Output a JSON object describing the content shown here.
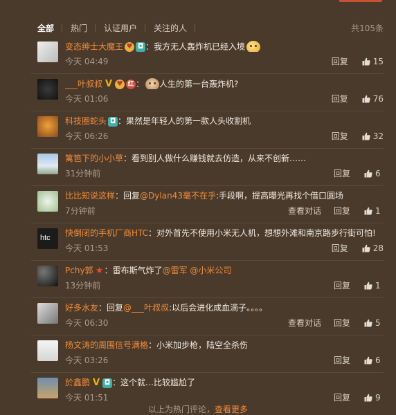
{
  "filters": [
    "全部",
    "热门",
    "认证用户",
    "关注的人"
  ],
  "active_filter": 0,
  "total": "共105条",
  "comments": [
    {
      "user": "变态绅士大魔王",
      "badges": [
        "heart",
        "camera"
      ],
      "segments": [
        {
          "t": "我方无人轰炸机已经入境"
        }
      ],
      "emoji": "face",
      "time": "今天 04:49",
      "dialog": "",
      "reply": "回复",
      "likes": "15",
      "avatar": "manga"
    },
    {
      "user": "___叶叔叔",
      "badges": [
        "v",
        "heart",
        "red"
      ],
      "segments": [],
      "emoji_before": "dog",
      "after_emoji": "人生的第一台轰炸机?",
      "time": "今天 01:06",
      "dialog": "",
      "reply": "回复",
      "likes": "76",
      "avatar": "dark"
    },
    {
      "user": "科技圈蛇头",
      "badges": [
        "camera"
      ],
      "segments": [
        {
          "t": "果然是年轻人的第一款人头收割机"
        }
      ],
      "time": "今天 06:26",
      "dialog": "",
      "reply": "回复",
      "likes": "32",
      "avatar": "orange"
    },
    {
      "user": "篱笆下的小小草",
      "badges": [],
      "segments": [
        {
          "t": "看到别人做什么赚钱就去仿造，从来不创新……"
        }
      ],
      "time": "31分钟前",
      "dialog": "",
      "reply": "回复",
      "likes": "6",
      "avatar": "sky"
    },
    {
      "user": "比比知说这样",
      "badges": [],
      "segments": [
        {
          "t": "回复"
        },
        {
          "m": "@Dylan43毫不在乎"
        },
        {
          "t": ":手段啊，提高曝光再找个借口圆场"
        }
      ],
      "time": "7分钟前",
      "dialog": "查看对话",
      "reply": "回复",
      "likes": "1",
      "avatar": "green"
    },
    {
      "user": "快倒闭的手机厂商HTC",
      "badges": [],
      "segments": [
        {
          "t": "对外首先不使用小米无人机，想想外滩和南京路步行街可怕!"
        }
      ],
      "time": "今天 01:53",
      "dialog": "",
      "reply": "回复",
      "likes": "28",
      "avatar": "htc"
    },
    {
      "user": "Pchy郭",
      "badges": [
        "star"
      ],
      "segments": [
        {
          "t": "雷布斯气炸了"
        },
        {
          "m": "@雷军"
        },
        {
          "t": " "
        },
        {
          "m": "@小米公司"
        }
      ],
      "time": "13分钟前",
      "dialog": "",
      "reply": "回复",
      "likes": "1",
      "avatar": "night"
    },
    {
      "user": "好多水友",
      "badges": [],
      "segments": [
        {
          "t": "回复"
        },
        {
          "m": "@___叶叔叔"
        },
        {
          "t": ":以后会进化成血滴子。。。。"
        }
      ],
      "time": "今天 06:30",
      "dialog": "查看对话",
      "reply": "回复",
      "likes": "5",
      "avatar": "cat"
    },
    {
      "user": "杨文涛的周围信号满格",
      "badges": [],
      "segments": [
        {
          "t": "小米加步枪，陆空全杀伤"
        }
      ],
      "time": "今天 03:26",
      "dialog": "",
      "reply": "回复",
      "likes": "6",
      "avatar": "white"
    },
    {
      "user": "於鑫鹏",
      "badges": [
        "v",
        "camera"
      ],
      "segments": [
        {
          "t": "这个就…比较尴尬了"
        }
      ],
      "time": "今天 01:51",
      "dialog": "",
      "reply": "回复",
      "likes": "9",
      "avatar": "bird"
    }
  ],
  "bottom": {
    "text": "以上为热门评论，",
    "more": "查看更多"
  }
}
